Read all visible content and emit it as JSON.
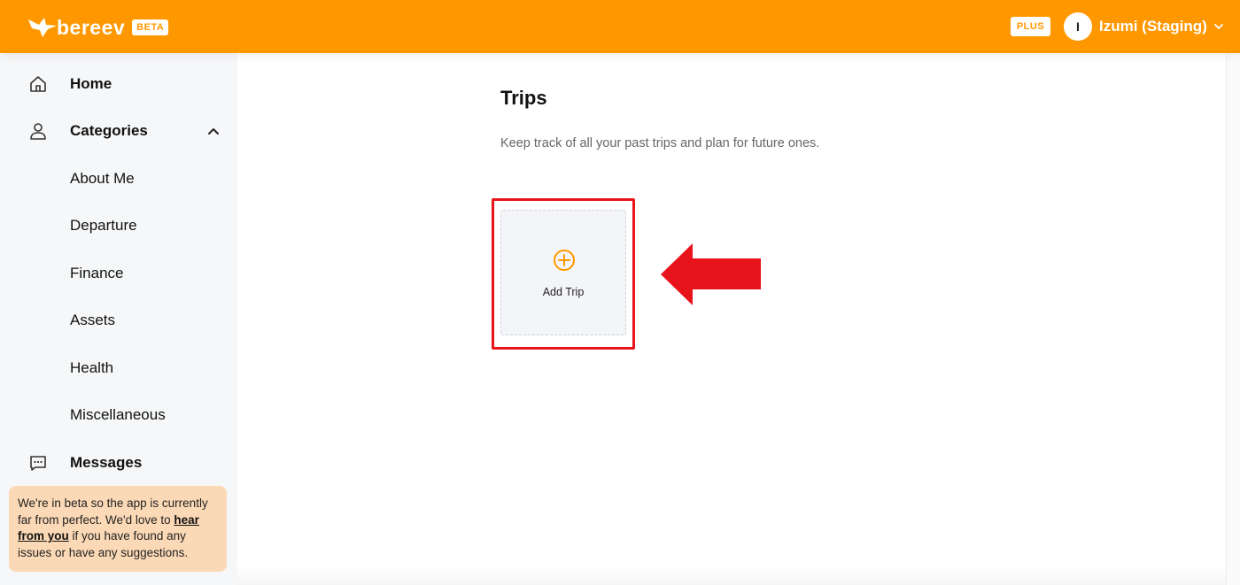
{
  "header": {
    "logo_text": "bereev",
    "beta_badge": "BETA",
    "plus_badge": "PLUS",
    "avatar_initial": "I",
    "user_name": "Izumi (Staging)"
  },
  "sidebar": {
    "items": [
      {
        "label": "Home",
        "icon": "home-icon"
      },
      {
        "label": "Categories",
        "icon": "person-icon"
      },
      {
        "label": "About Me"
      },
      {
        "label": "Departure"
      },
      {
        "label": "Finance"
      },
      {
        "label": "Assets"
      },
      {
        "label": "Health"
      },
      {
        "label": "Miscellaneous"
      },
      {
        "label": "Messages",
        "icon": "message-icon"
      }
    ],
    "beta_note": {
      "text_before": "We're in beta so the app is currently far from perfect. We'd love to ",
      "link": "hear from you",
      "text_after": " if you have found any issues or have any suggestions."
    }
  },
  "main": {
    "title": "Trips",
    "description": "Keep track of all your past trips and plan for future ones.",
    "add_trip_label": "Add Trip"
  },
  "colors": {
    "brand": "#FF9800",
    "highlight": "#E8141B",
    "beta_note_bg": "#FCD9B6",
    "sidebar_bg": "#f6f7f8"
  }
}
